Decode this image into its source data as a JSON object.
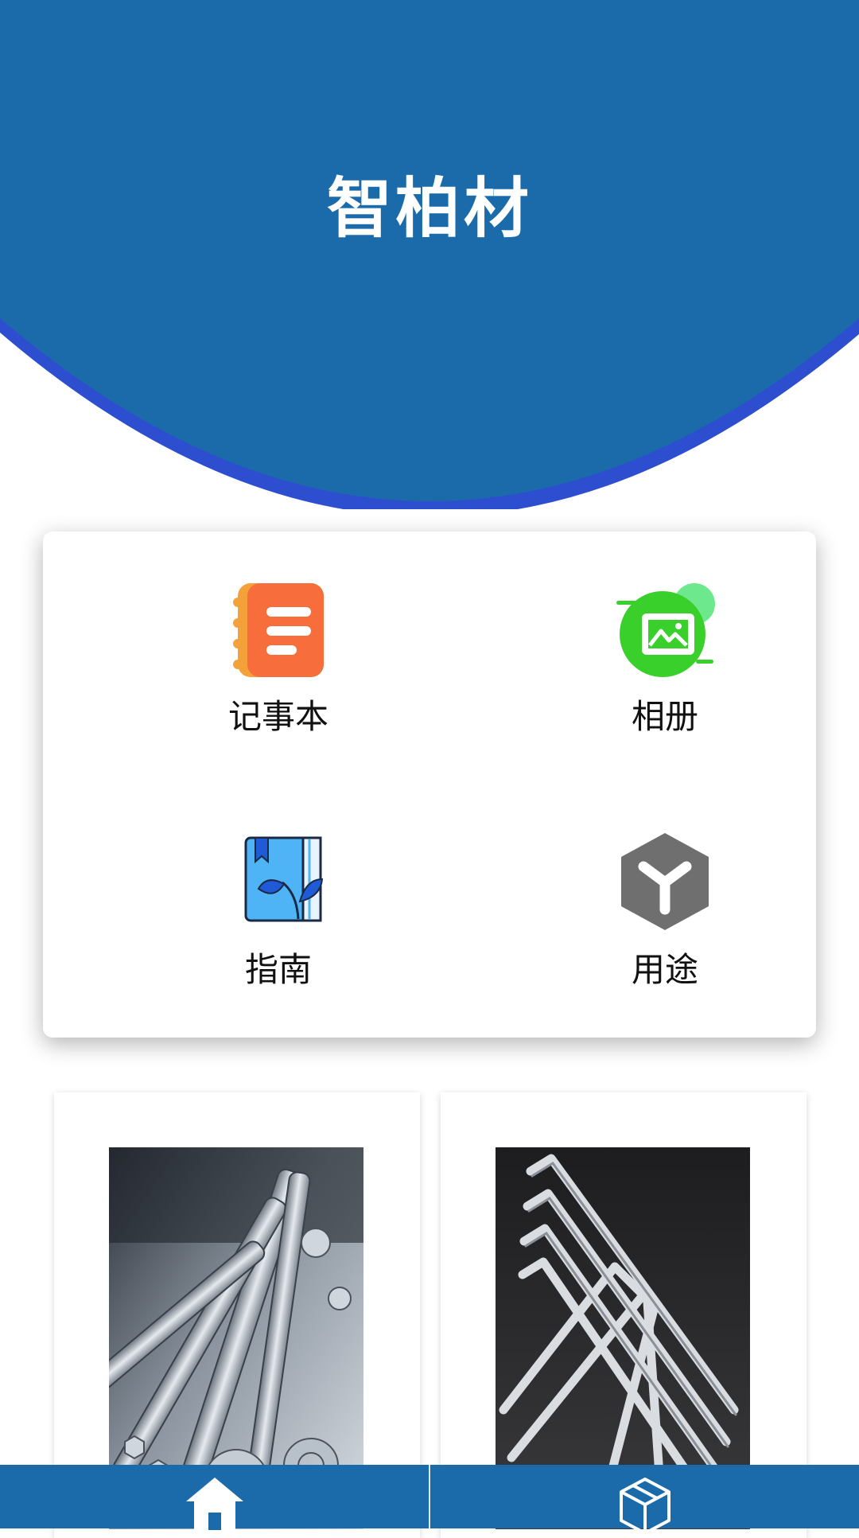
{
  "header": {
    "title": "智柏材",
    "background_color": "#1b6bab",
    "arc_edge_color": "#2d4fcf"
  },
  "menu": {
    "items": [
      {
        "label": "记事本",
        "icon": "notebook-icon"
      },
      {
        "label": "相册",
        "icon": "photo-album-icon"
      },
      {
        "label": "指南",
        "icon": "guide-book-icon"
      },
      {
        "label": "用途",
        "icon": "usage-cube-icon"
      }
    ]
  },
  "products": [
    {
      "image": "wrenches-photo"
    },
    {
      "image": "hex-keys-photo"
    }
  ],
  "bottom_nav": {
    "tabs": [
      {
        "icon": "home-icon"
      },
      {
        "icon": "cube-icon"
      }
    ]
  }
}
